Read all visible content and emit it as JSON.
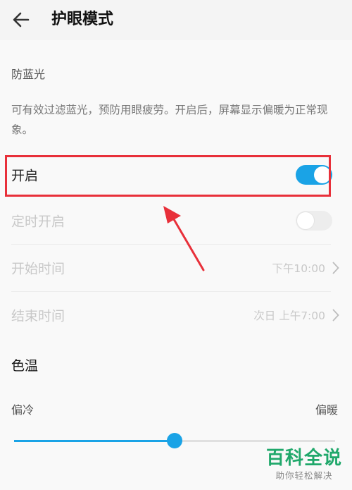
{
  "header": {
    "back_icon": "arrow-left-icon",
    "title": "护眼模式"
  },
  "blue_light": {
    "section_label": "防蓝光",
    "description": "可有效过滤蓝光，预防用眼疲劳。开启后，屏幕显示偏暖为正常现象。"
  },
  "settings": {
    "enable": {
      "label": "开启",
      "toggle_on": true
    },
    "scheduled": {
      "label": "定时开启",
      "toggle_on": false
    },
    "start_time": {
      "label": "开始时间",
      "value": "下午10:00"
    },
    "end_time": {
      "label": "结束时间",
      "value": "次日 上午7:00"
    }
  },
  "color_temp": {
    "title": "色温",
    "left_label": "偏冷",
    "right_label": "偏暖",
    "value_fraction": 0.5
  },
  "colors": {
    "accent": "#1aa3e6",
    "highlight": "#e8303a",
    "watermark": "#20a86b"
  },
  "watermark": {
    "main": "百科全说",
    "sub": "助你轻松解决"
  }
}
